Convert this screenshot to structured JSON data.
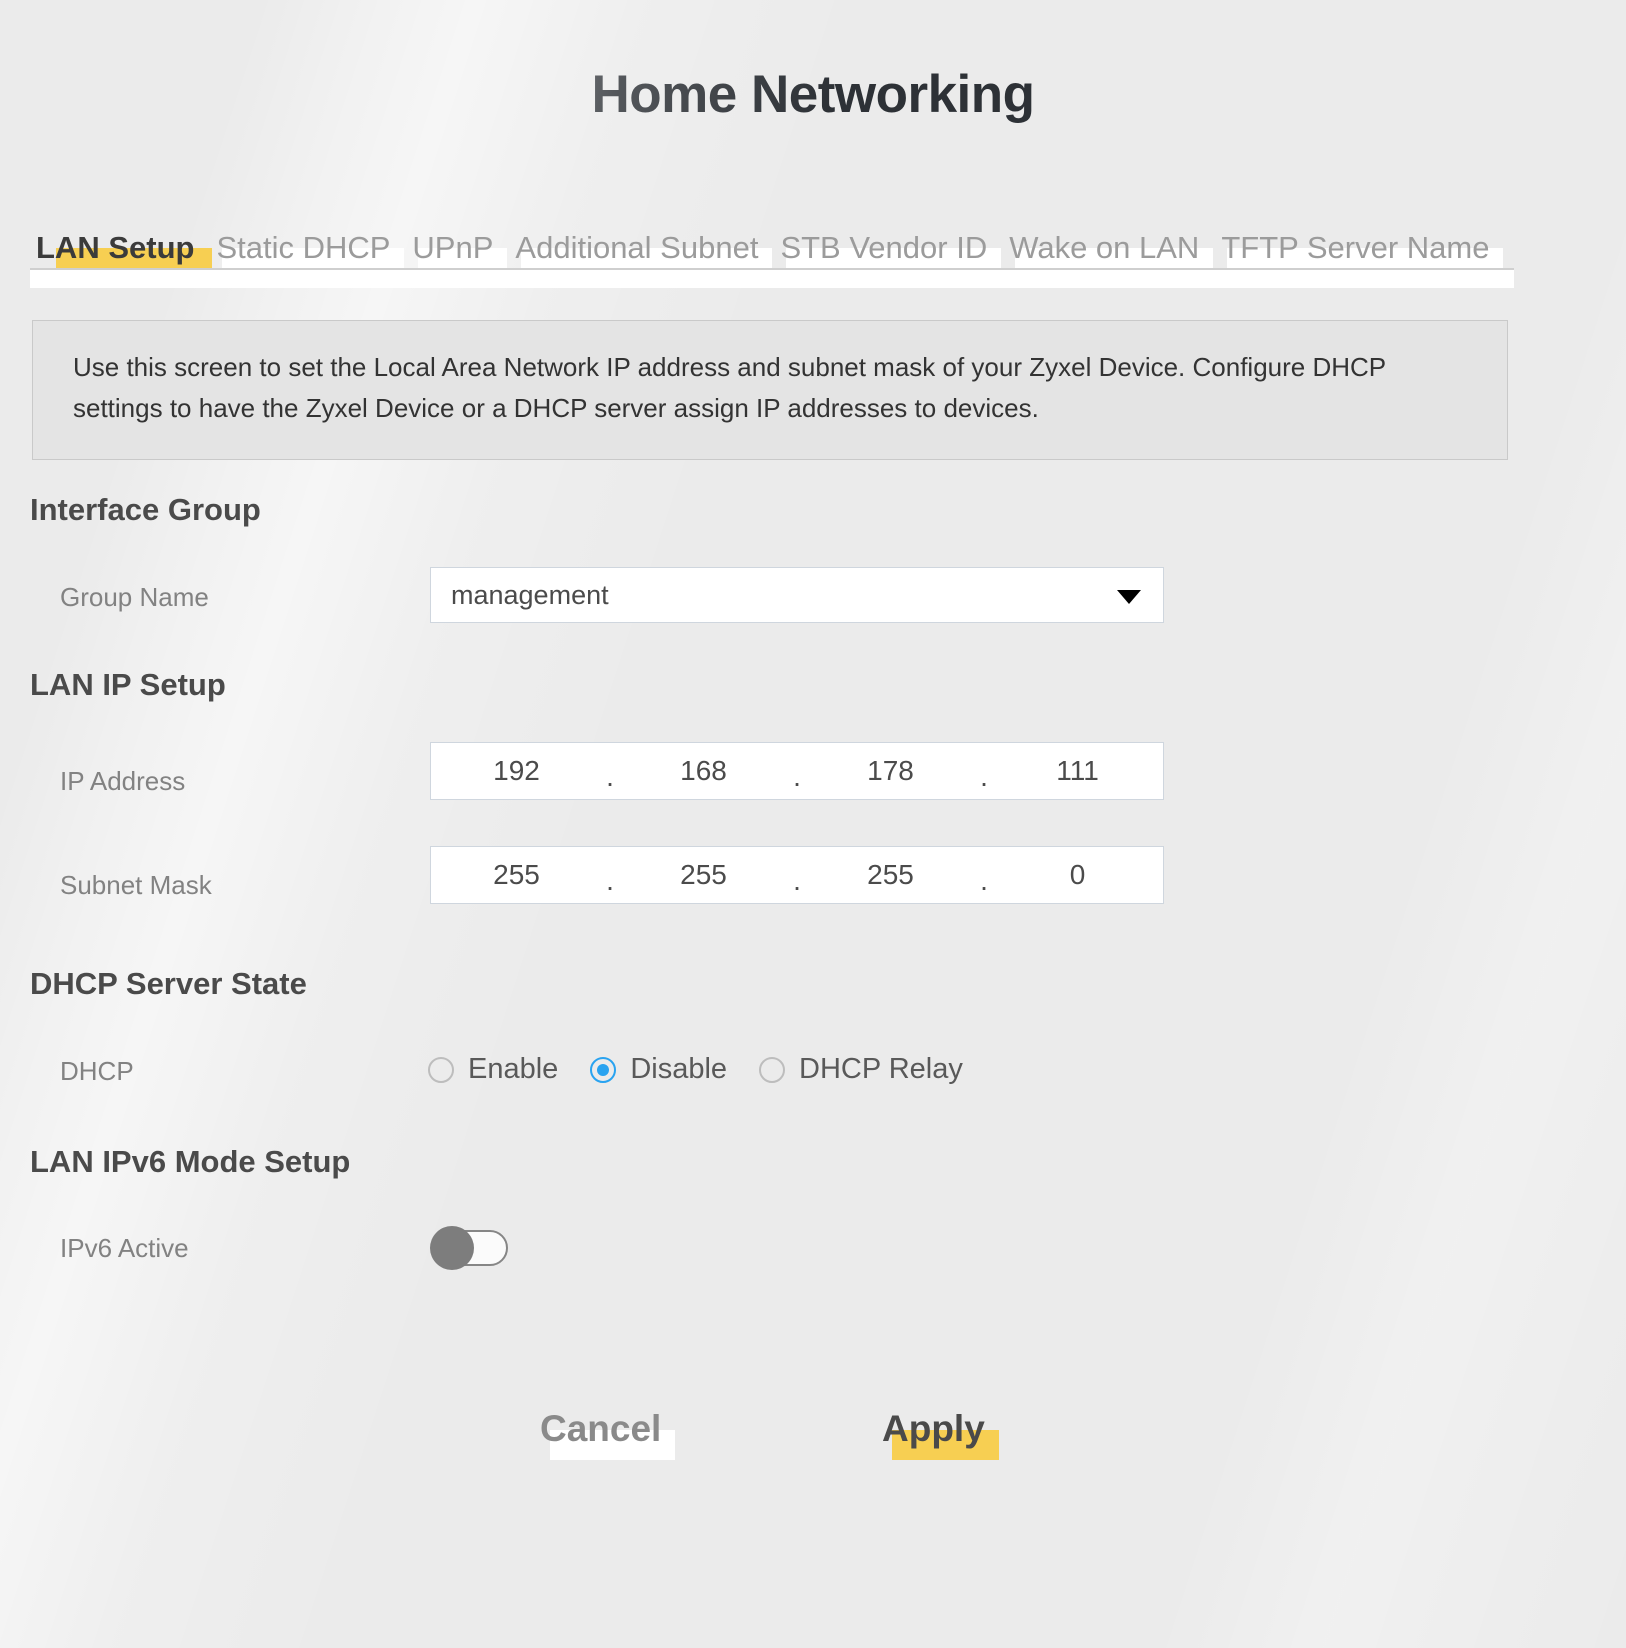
{
  "header": {
    "title": "Home Networking"
  },
  "tabs": [
    {
      "label": "LAN Setup",
      "active": true
    },
    {
      "label": "Static DHCP",
      "active": false
    },
    {
      "label": "UPnP",
      "active": false
    },
    {
      "label": "Additional Subnet",
      "active": false
    },
    {
      "label": "STB Vendor ID",
      "active": false
    },
    {
      "label": "Wake on LAN",
      "active": false
    },
    {
      "label": "TFTP Server Name",
      "active": false
    }
  ],
  "description": "Use this screen to set the Local Area Network IP address and subnet mask of your Zyxel Device. Configure DHCP settings to have the Zyxel Device or a DHCP server assign IP addresses to devices.",
  "sections": {
    "interface_group": {
      "heading": "Interface Group",
      "group_name": {
        "label": "Group Name",
        "value": "management",
        "icon": "chevron-down-icon"
      }
    },
    "lan_ip_setup": {
      "heading": "LAN IP Setup",
      "ip_address": {
        "label": "IP Address",
        "octets": [
          "192",
          "168",
          "178",
          "111"
        ],
        "separator": "."
      },
      "subnet_mask": {
        "label": "Subnet Mask",
        "octets": [
          "255",
          "255",
          "255",
          "0"
        ],
        "separator": "."
      }
    },
    "dhcp_server_state": {
      "heading": "DHCP Server State",
      "dhcp": {
        "label": "DHCP",
        "options": [
          "Enable",
          "Disable",
          "DHCP Relay"
        ],
        "selected": "Disable"
      }
    },
    "lan_ipv6_mode_setup": {
      "heading": "LAN IPv6 Mode Setup",
      "ipv6_active": {
        "label": "IPv6 Active",
        "state": "off"
      }
    }
  },
  "footer": {
    "cancel_label": "Cancel",
    "apply_label": "Apply"
  },
  "colors": {
    "page_background": "#ebebeb",
    "accent_gold": "#f7cf52",
    "radio_selected": "#29a3f0",
    "heading_text": "#4a4a4a",
    "label_text": "#828282",
    "description_background": "#e4e4e4"
  }
}
